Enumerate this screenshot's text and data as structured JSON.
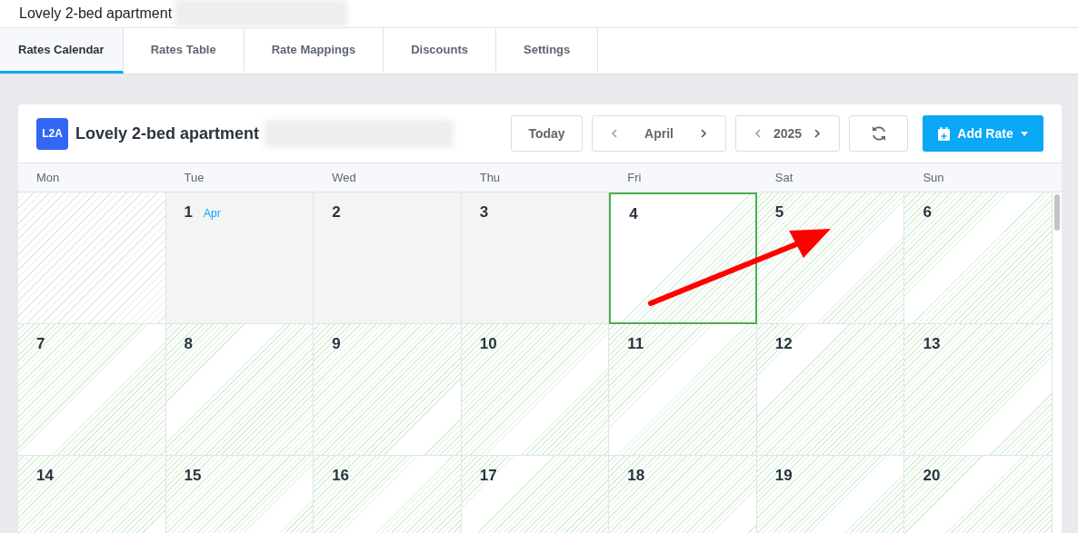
{
  "page_title": "Lovely 2-bed apartment",
  "tabs": [
    {
      "label": "Rates Calendar",
      "selected": true
    },
    {
      "label": "Rates Table",
      "selected": false
    },
    {
      "label": "Rate Mappings",
      "selected": false
    },
    {
      "label": "Discounts",
      "selected": false
    },
    {
      "label": "Settings",
      "selected": false
    }
  ],
  "calendar": {
    "badge": "L2A",
    "title": "Lovely 2-bed apartment",
    "today_button": "Today",
    "month": "April",
    "year": "2025",
    "add_button": "Add Rate",
    "weekdays": [
      "Mon",
      "Tue",
      "Wed",
      "Thu",
      "Fri",
      "Sat",
      "Sun"
    ],
    "weeks": [
      [
        {
          "kind": "outside",
          "selected": false
        },
        {
          "day": "1",
          "month_label": "Apr",
          "kind": "past",
          "selected": false
        },
        {
          "day": "2",
          "kind": "past",
          "selected": false
        },
        {
          "day": "3",
          "kind": "past",
          "selected": false
        },
        {
          "day": "4",
          "kind": "available",
          "selected": true
        },
        {
          "day": "5",
          "kind": "available",
          "selected": false
        },
        {
          "day": "6",
          "kind": "available",
          "selected": false
        }
      ],
      [
        {
          "day": "7",
          "kind": "available",
          "selected": false
        },
        {
          "day": "8",
          "kind": "available",
          "selected": false
        },
        {
          "day": "9",
          "kind": "available",
          "selected": false
        },
        {
          "day": "10",
          "kind": "available",
          "selected": false
        },
        {
          "day": "11",
          "kind": "available",
          "selected": false
        },
        {
          "day": "12",
          "kind": "available",
          "selected": false
        },
        {
          "day": "13",
          "kind": "available",
          "selected": false
        }
      ],
      [
        {
          "day": "14",
          "kind": "available",
          "selected": false
        },
        {
          "day": "15",
          "kind": "available",
          "selected": false
        },
        {
          "day": "16",
          "kind": "available",
          "selected": false
        },
        {
          "day": "17",
          "kind": "available",
          "selected": false
        },
        {
          "day": "18",
          "kind": "available",
          "selected": false
        },
        {
          "day": "19",
          "kind": "available",
          "selected": false
        },
        {
          "day": "20",
          "kind": "available",
          "selected": false
        }
      ]
    ]
  }
}
